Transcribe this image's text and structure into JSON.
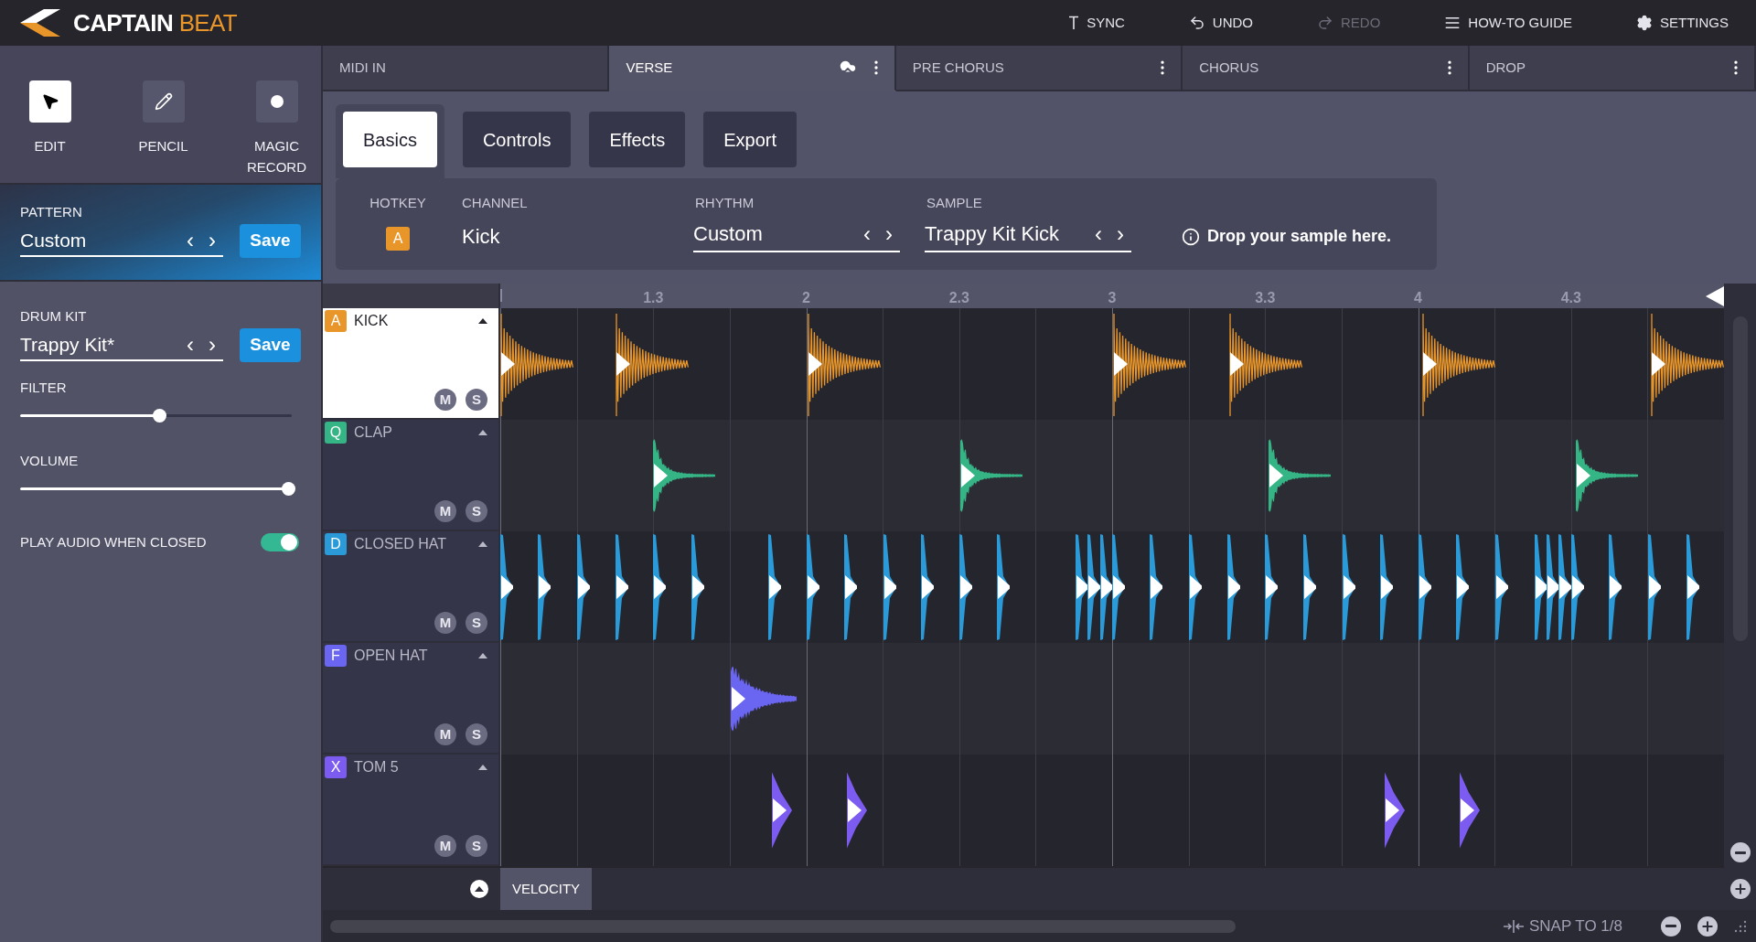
{
  "app": {
    "title_first": "CAPTAIN",
    "title_second": "BEAT"
  },
  "toolbar": [
    {
      "kind": "sync",
      "label": "SYNC",
      "disabled": false
    },
    {
      "kind": "undo",
      "label": "UNDO",
      "disabled": false
    },
    {
      "kind": "redo",
      "label": "REDO",
      "disabled": true
    },
    {
      "kind": "guide",
      "label": "HOW-TO GUIDE",
      "disabled": false
    },
    {
      "kind": "settings",
      "label": "SETTINGS",
      "disabled": false
    }
  ],
  "tools": [
    {
      "kind": "edit",
      "label": "EDIT",
      "selected": true
    },
    {
      "kind": "pencil",
      "label": "PENCIL",
      "selected": false
    },
    {
      "kind": "record",
      "label": "MAGIC RECORD",
      "selected": false
    }
  ],
  "pattern": {
    "label": "PATTERN",
    "value": "Custom",
    "prev": "‹",
    "next": "›",
    "button": "Save"
  },
  "drum_kit": {
    "label": "DRUM KIT",
    "value": "Trappy Kit*",
    "prev": "‹",
    "next": "›",
    "button": "Save"
  },
  "filter": {
    "label": "FILTER",
    "level": 0.5
  },
  "volume": {
    "label": "VOLUME",
    "level": 0.99
  },
  "play_audio": {
    "label": "PLAY AUDIO WHEN CLOSED",
    "on": true
  },
  "sections": [
    {
      "label": "MIDI IN",
      "selected": false,
      "menu": false,
      "cloud": false
    },
    {
      "label": "VERSE",
      "selected": true,
      "menu": true,
      "cloud": true
    },
    {
      "label": "PRE CHORUS",
      "selected": false,
      "menu": true,
      "cloud": false
    },
    {
      "label": "CHORUS",
      "selected": false,
      "menu": true,
      "cloud": false
    },
    {
      "label": "DROP",
      "selected": false,
      "menu": true,
      "cloud": false
    }
  ],
  "subtabs": [
    {
      "label": "Basics",
      "selected": true
    },
    {
      "label": "Controls",
      "selected": false
    },
    {
      "label": "Effects",
      "selected": false
    },
    {
      "label": "Export",
      "selected": false
    }
  ],
  "basics": {
    "hotkey_label": "HOTKEY",
    "hotkey": "A",
    "channel_label": "CHANNEL",
    "channel": "Kick",
    "rhythm_label": "RHYTHM",
    "rhythm": "Custom",
    "rhythm_prev": "‹",
    "rhythm_next": "›",
    "sample_label": "SAMPLE",
    "sample": "Trappy Kit Kick",
    "sample_prev": "‹",
    "sample_next": "›",
    "drop_hint": "Drop your sample here."
  },
  "ruler": {
    "labels": [
      "1.3",
      "2",
      "2.3",
      "3",
      "3.3",
      "4",
      "4.3"
    ]
  },
  "tracks": [
    {
      "hotkey": "A",
      "name": "KICK",
      "color": "#e8952a",
      "selected": true,
      "kind": "tonal",
      "mute": "M",
      "solo": "S",
      "notes": [
        {
          "level": 0.0
        },
        {
          "level": 0.094
        },
        {
          "level": 0.251
        },
        {
          "level": 0.501
        },
        {
          "level": 0.596
        },
        {
          "level": 0.753
        },
        {
          "level": 0.94
        }
      ]
    },
    {
      "hotkey": "Q",
      "name": "CLAP",
      "color": "#35b585",
      "selected": false,
      "kind": "noise",
      "mute": "M",
      "solo": "S",
      "notes": [
        {
          "level": 0.125
        },
        {
          "level": 0.376
        },
        {
          "level": 0.628
        },
        {
          "level": 0.879
        }
      ]
    },
    {
      "hotkey": "D",
      "name": "CLOSED HAT",
      "color": "#2a9ad8",
      "selected": false,
      "kind": "tick",
      "mute": "M",
      "solo": "S",
      "notes": [
        {
          "level": 0.0
        },
        {
          "level": 0.031
        },
        {
          "level": 0.063
        },
        {
          "level": 0.094
        },
        {
          "level": 0.125
        },
        {
          "level": 0.156
        },
        {
          "level": 0.219
        },
        {
          "level": 0.25
        },
        {
          "level": 0.281
        },
        {
          "level": 0.313
        },
        {
          "level": 0.344
        },
        {
          "level": 0.375
        },
        {
          "level": 0.406
        },
        {
          "level": 0.47
        },
        {
          "level": 0.48
        },
        {
          "level": 0.49
        },
        {
          "level": 0.5
        },
        {
          "level": 0.531
        },
        {
          "level": 0.563
        },
        {
          "level": 0.594
        },
        {
          "level": 0.625
        },
        {
          "level": 0.656
        },
        {
          "level": 0.688
        },
        {
          "level": 0.719
        },
        {
          "level": 0.75
        },
        {
          "level": 0.781
        },
        {
          "level": 0.813
        },
        {
          "level": 0.845
        },
        {
          "level": 0.855
        },
        {
          "level": 0.865
        },
        {
          "level": 0.875
        },
        {
          "level": 0.906
        },
        {
          "level": 0.938
        },
        {
          "level": 0.969
        }
      ]
    },
    {
      "hotkey": "F",
      "name": "OPEN HAT",
      "color": "#6a66f2",
      "selected": false,
      "kind": "burst",
      "mute": "M",
      "solo": "S",
      "notes": [
        {
          "level": 0.188
        }
      ]
    },
    {
      "hotkey": "X",
      "name": "TOM 5",
      "color": "#7c5cf0",
      "selected": false,
      "kind": "thump",
      "mute": "M",
      "solo": "S",
      "notes": [
        {
          "level": 0.222
        },
        {
          "level": 0.283
        },
        {
          "level": 0.723
        },
        {
          "level": 0.784
        }
      ]
    }
  ],
  "velocity": {
    "label": "VELOCITY"
  },
  "status": {
    "snap": "SNAP TO 1/8"
  }
}
